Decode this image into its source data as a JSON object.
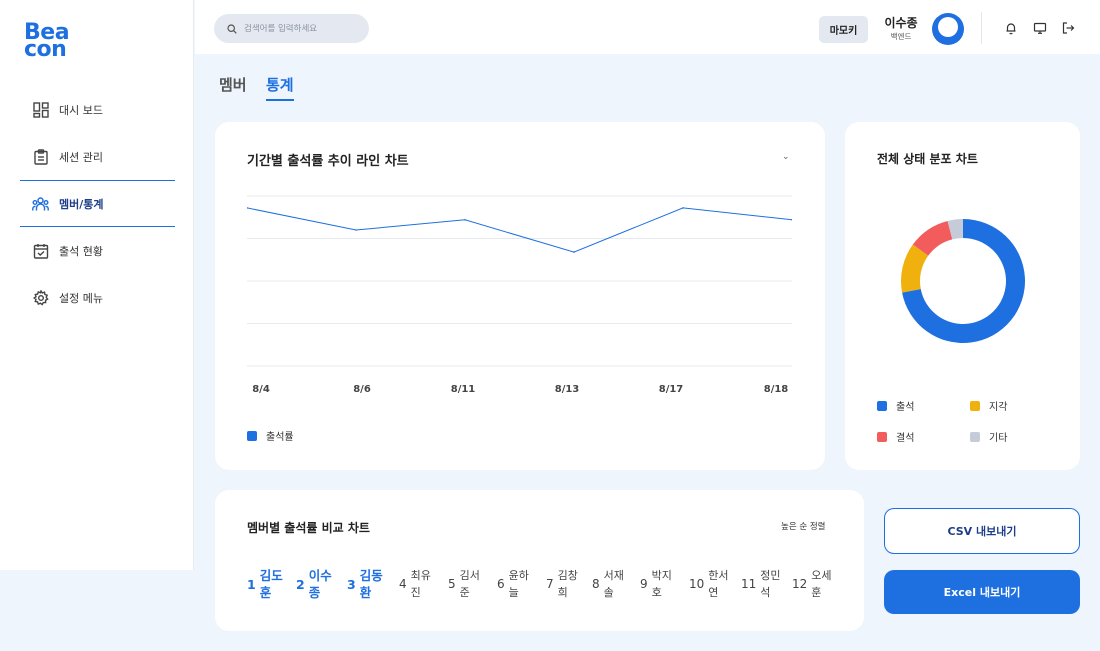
{
  "brand": {
    "logo_line1": "Bea",
    "logo_line2": "con"
  },
  "sidebar": {
    "items": [
      {
        "label": "대시 보드",
        "icon": "dashboard-icon",
        "active": false
      },
      {
        "label": "세션 관리",
        "icon": "clipboard-icon",
        "active": false
      },
      {
        "label": "멤버/통계",
        "icon": "users-icon",
        "active": true
      },
      {
        "label": "출석 현황",
        "icon": "calendar-check-icon",
        "active": false
      },
      {
        "label": "설정 메뉴",
        "icon": "gear-icon",
        "active": false
      }
    ]
  },
  "header": {
    "search_placeholder": "검색어를 입력하세요",
    "badge": "마모키",
    "user_name": "이수종",
    "user_role": "백엔드",
    "icons": [
      "bell-icon",
      "monitor-icon",
      "logout-icon"
    ]
  },
  "tabs": [
    {
      "label": "멤버",
      "active": false
    },
    {
      "label": "통계",
      "active": true
    }
  ],
  "colors": {
    "primary": "#1e6fe0",
    "present": "#1e6fe0",
    "late": "#f0b10f",
    "absent": "#f25c5c",
    "other": "#c5ccd8"
  },
  "line_card": {
    "title": "기간별 출석률 추이 라인 차트",
    "dropdown": "⌄"
  },
  "donut_card": {
    "title": "전체 상태 분포 차트"
  },
  "bar_card": {
    "title": "멤버별 출석률 비교 차트",
    "sort_label": "높은 순 정렬"
  },
  "ranking": [
    {
      "rank": "1",
      "name": "김도훈",
      "top": true
    },
    {
      "rank": "2",
      "name": "이수종",
      "top": true
    },
    {
      "rank": "3",
      "name": "김동환",
      "top": true
    },
    {
      "rank": "4",
      "name": "최유진",
      "top": false
    },
    {
      "rank": "5",
      "name": "김서준",
      "top": false
    },
    {
      "rank": "6",
      "name": "윤하늘",
      "top": false
    },
    {
      "rank": "7",
      "name": "김창희",
      "top": false
    },
    {
      "rank": "8",
      "name": "서재솔",
      "top": false
    },
    {
      "rank": "9",
      "name": "박지호",
      "top": false
    },
    {
      "rank": "10",
      "name": "한서연",
      "top": false
    },
    {
      "rank": "11",
      "name": "정민석",
      "top": false
    },
    {
      "rank": "12",
      "name": "오세훈",
      "top": false
    }
  ],
  "buttons": {
    "csv": "CSV 내보내기",
    "excel": "Excel 내보내기"
  },
  "chart_data": [
    {
      "type": "line",
      "title": "기간별 출석률 추이 라인 차트",
      "x": [
        "8/4",
        "8/6",
        "8/11",
        "8/13",
        "8/17",
        "8/18"
      ],
      "series": [
        {
          "name": "출석률",
          "values": [
            93,
            80,
            86,
            67,
            93,
            86
          ],
          "color": "#1e6fe0"
        }
      ],
      "ylim": [
        0,
        100
      ],
      "grid": true,
      "legend": "bottom-left"
    },
    {
      "type": "pie",
      "title": "전체 상태 분포 차트",
      "donut": true,
      "labels": [
        "출석",
        "지각",
        "결석",
        "기타"
      ],
      "values": [
        72,
        13,
        11,
        4
      ],
      "colors": [
        "#1e6fe0",
        "#f0b10f",
        "#f25c5c",
        "#c5ccd8"
      ],
      "legend": "bottom"
    }
  ]
}
